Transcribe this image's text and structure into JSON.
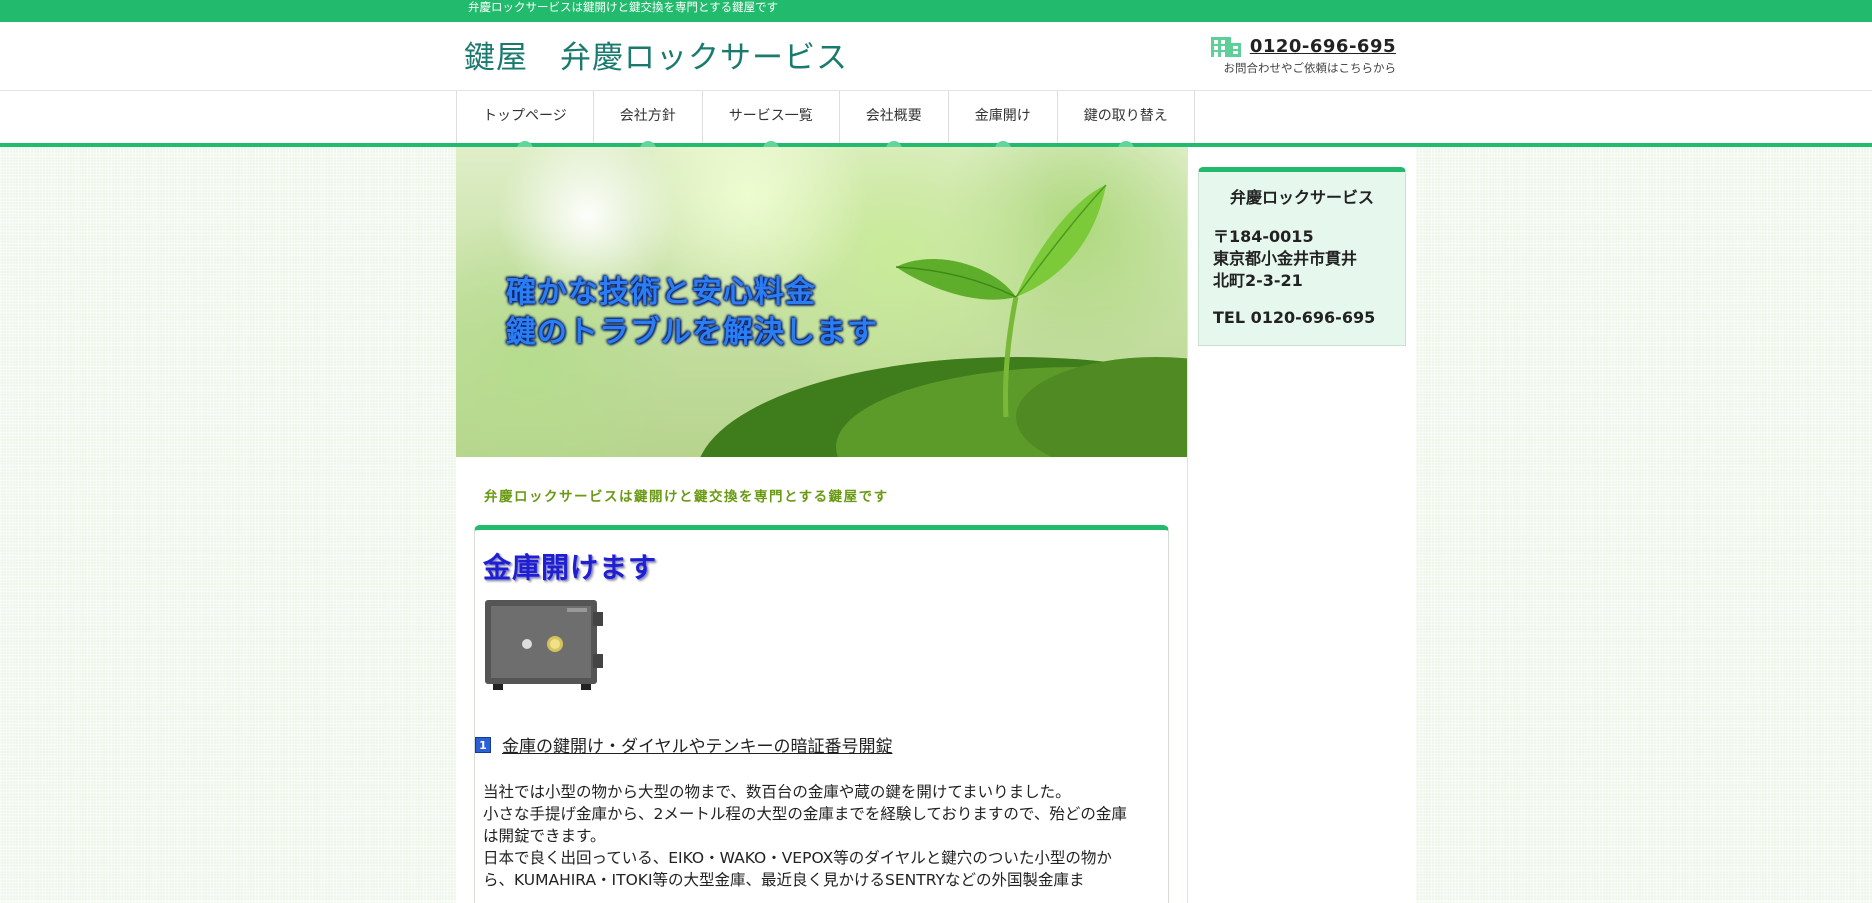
{
  "topbar": {
    "text": "弁慶ロックサービスは鍵開けと鍵交換を専門とする鍵屋です"
  },
  "header": {
    "title": "鍵屋　弁慶ロックサービス",
    "phone": "0120-696-695",
    "phone_note": "お問合わせやご依頼はこちらから",
    "phone_icon": "building-icon"
  },
  "nav": {
    "items": [
      {
        "label": "トップページ"
      },
      {
        "label": "会社方針"
      },
      {
        "label": "サービス一覧"
      },
      {
        "label": "会社概要"
      },
      {
        "label": "金庫開け"
      },
      {
        "label": "鍵の取り替え"
      }
    ]
  },
  "hero": {
    "line1": "確かな技術と安心料金",
    "line2": "鍵のトラブルを解決します"
  },
  "main": {
    "tagline": "弁慶ロックサービスは鍵開けと鍵交換を専門とする鍵屋です",
    "heading": "金庫開けます",
    "subheading_number": "1",
    "subheading": "金庫の鍵開け・ダイヤルやテンキーの暗証番号開錠",
    "paragraphs": [
      "当社では小型の物から大型の物まで、数百台の金庫や蔵の鍵を開けてまいりました。",
      "小さな手提げ金庫から、2メートル程の大型の金庫までを経験しておりますので、殆どの金庫は開錠できます。",
      "日本で良く出回っている、EIKO・WAKO・VEPOX等のダイヤルと鍵穴のついた小型の物から、KUMAHIRA・ITOKI等の大型金庫、最近良く見かけるSENTRYなどの外国製金庫ま"
    ]
  },
  "sidebar": {
    "title": "弁慶ロックサービス",
    "postal": "〒184-0015",
    "address1": "東京都小金井市貫井",
    "address2": "北町2-3-21",
    "tel": "TEL 0120-696-695"
  },
  "colors": {
    "accent": "#22bb6d",
    "heading": "#1f1fd0",
    "tagline": "#6a9a14",
    "hero_text": "#2b7df2"
  }
}
